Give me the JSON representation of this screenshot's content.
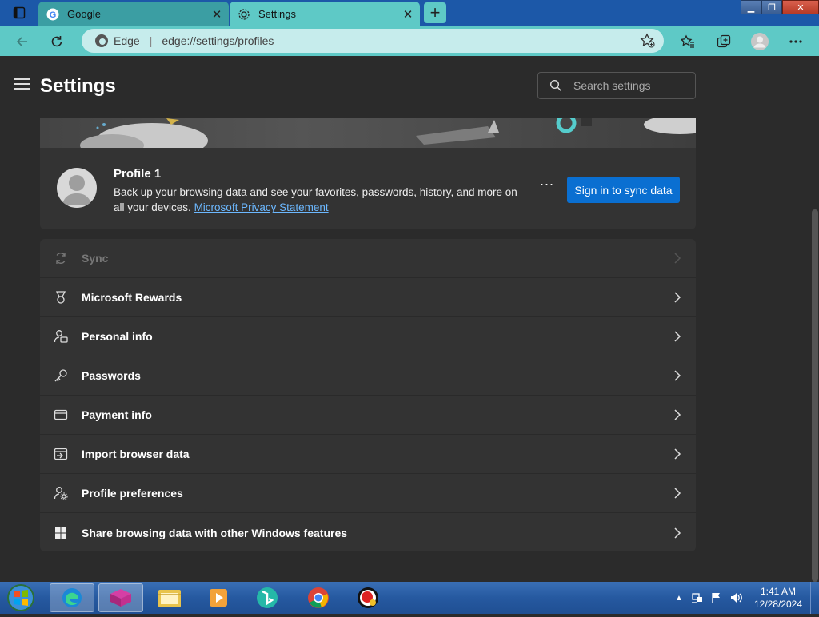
{
  "browser": {
    "tabs": [
      {
        "label": "Google",
        "active": false
      },
      {
        "label": "Settings",
        "active": true
      }
    ],
    "address": {
      "site_label": "Edge",
      "url": "edge://settings/profiles"
    }
  },
  "settings": {
    "title": "Settings",
    "search_placeholder": "Search settings"
  },
  "profile": {
    "name": "Profile 1",
    "description": "Back up your browsing data and see your favorites, passwords, history, and more on all your devices.",
    "privacy_link": "Microsoft Privacy Statement",
    "more_label": "...",
    "sync_button": "Sign in to sync data"
  },
  "menu": [
    {
      "label": "Sync",
      "icon": "sync-icon",
      "disabled": true
    },
    {
      "label": "Microsoft Rewards",
      "icon": "rewards-medal-icon",
      "disabled": false
    },
    {
      "label": "Personal info",
      "icon": "personal-info-icon",
      "disabled": false
    },
    {
      "label": "Passwords",
      "icon": "key-icon",
      "disabled": false
    },
    {
      "label": "Payment info",
      "icon": "credit-card-icon",
      "disabled": false
    },
    {
      "label": "Import browser data",
      "icon": "import-icon",
      "disabled": false
    },
    {
      "label": "Profile preferences",
      "icon": "profile-preferences-icon",
      "disabled": false
    },
    {
      "label": "Share browsing data with other Windows features",
      "icon": "windows-logo-icon",
      "disabled": false
    }
  ],
  "taskbar": {
    "apps": [
      "edge-icon",
      "winrar-icon",
      "file-explorer-icon",
      "media-player-icon",
      "bing-icon",
      "chrome-icon",
      "recorder-icon"
    ],
    "clock": {
      "time": "1:41 AM",
      "date": "12/28/2024"
    }
  },
  "colors": {
    "accent": "#0a6fd1",
    "toolbar": "#5ec9c6",
    "link": "#6cb8ff"
  }
}
